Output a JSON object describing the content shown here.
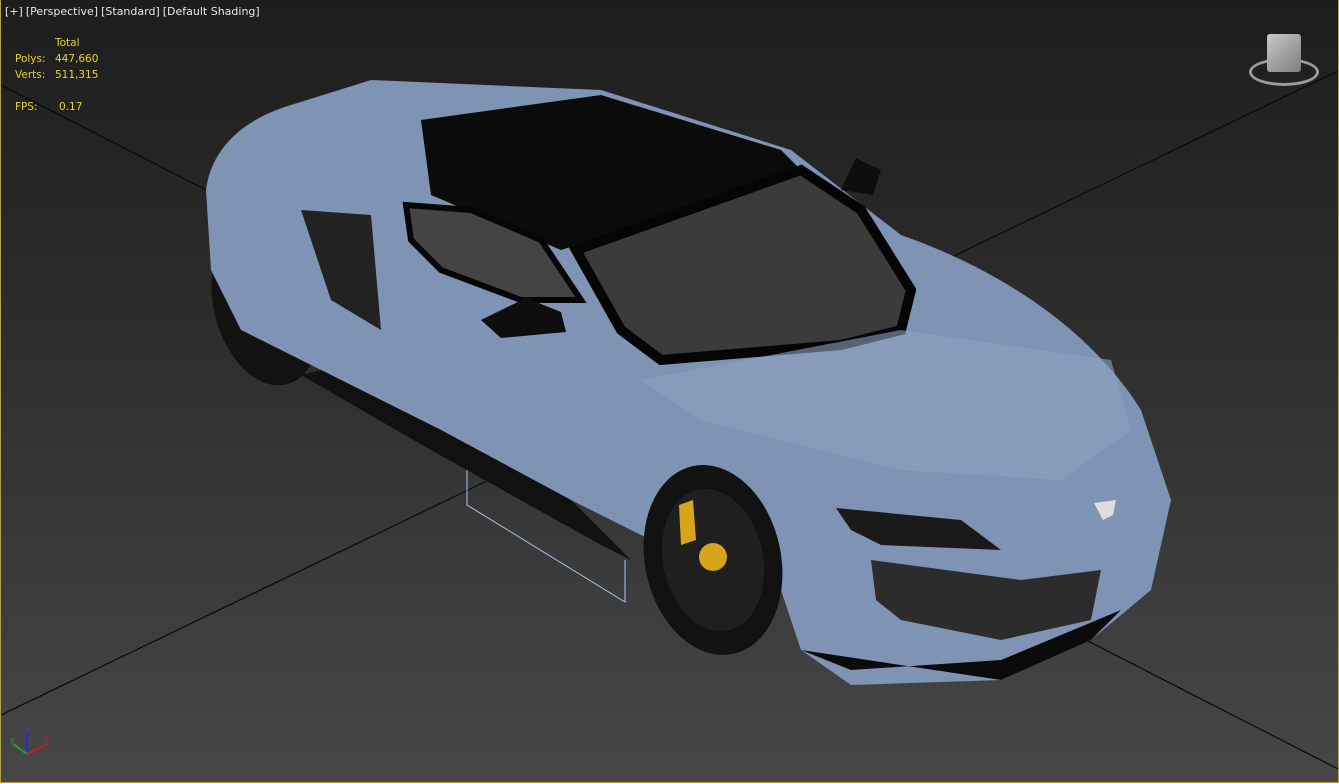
{
  "viewport_labels": {
    "plus": "[+]",
    "view": "[Perspective]",
    "mode": "[Standard]",
    "shading": "[Default Shading]"
  },
  "stats": {
    "header": "Total",
    "polys_label": "Polys:",
    "polys": "447,660",
    "verts_label": "Verts:",
    "verts": "511,315",
    "fps_label": "FPS:",
    "fps": "0.17"
  },
  "axis": {
    "z": "z",
    "x": "x",
    "y": "y"
  },
  "colors": {
    "border": "#b3a04a",
    "stats": "#e6d32a",
    "car_body": "#7f93b4"
  }
}
